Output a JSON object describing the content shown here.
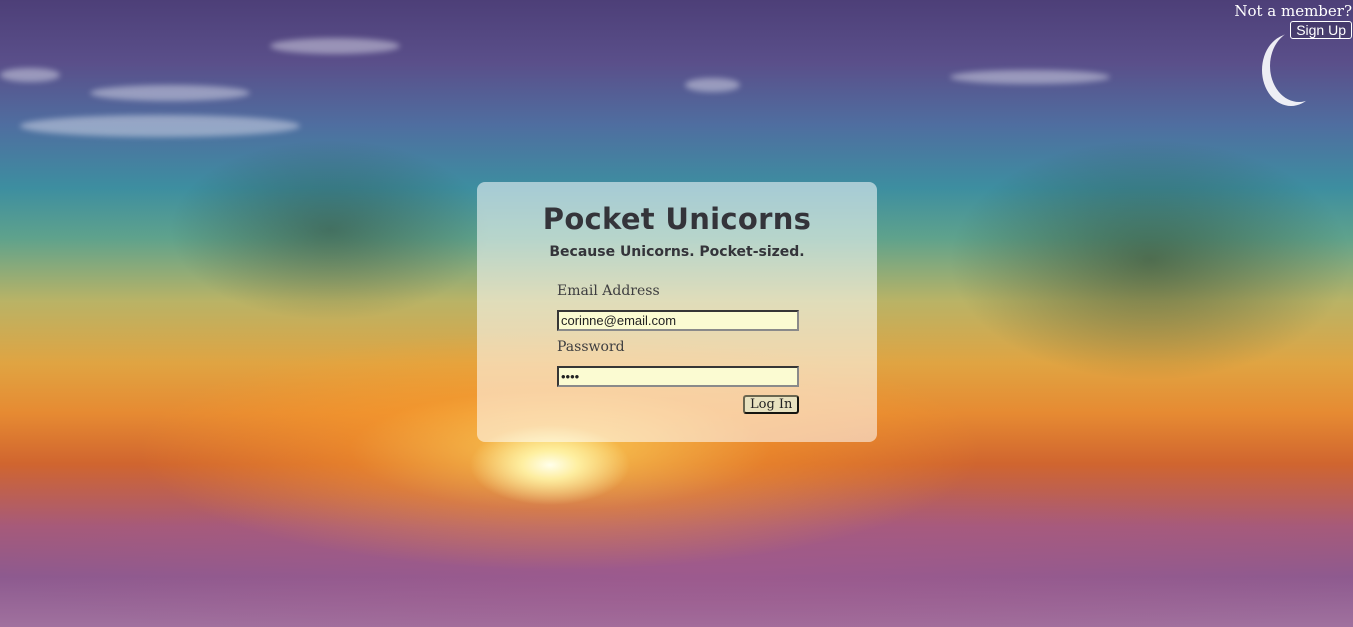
{
  "header": {
    "prompt_text": "Not a member?",
    "signup_label": "Sign Up"
  },
  "login": {
    "title": "Pocket Unicorns",
    "subtitle": "Because Unicorns. Pocket-sized.",
    "email_label": "Email Address",
    "email_value": "corinne@email.com",
    "password_label": "Password",
    "password_value": "••••",
    "login_label": "Log In"
  }
}
